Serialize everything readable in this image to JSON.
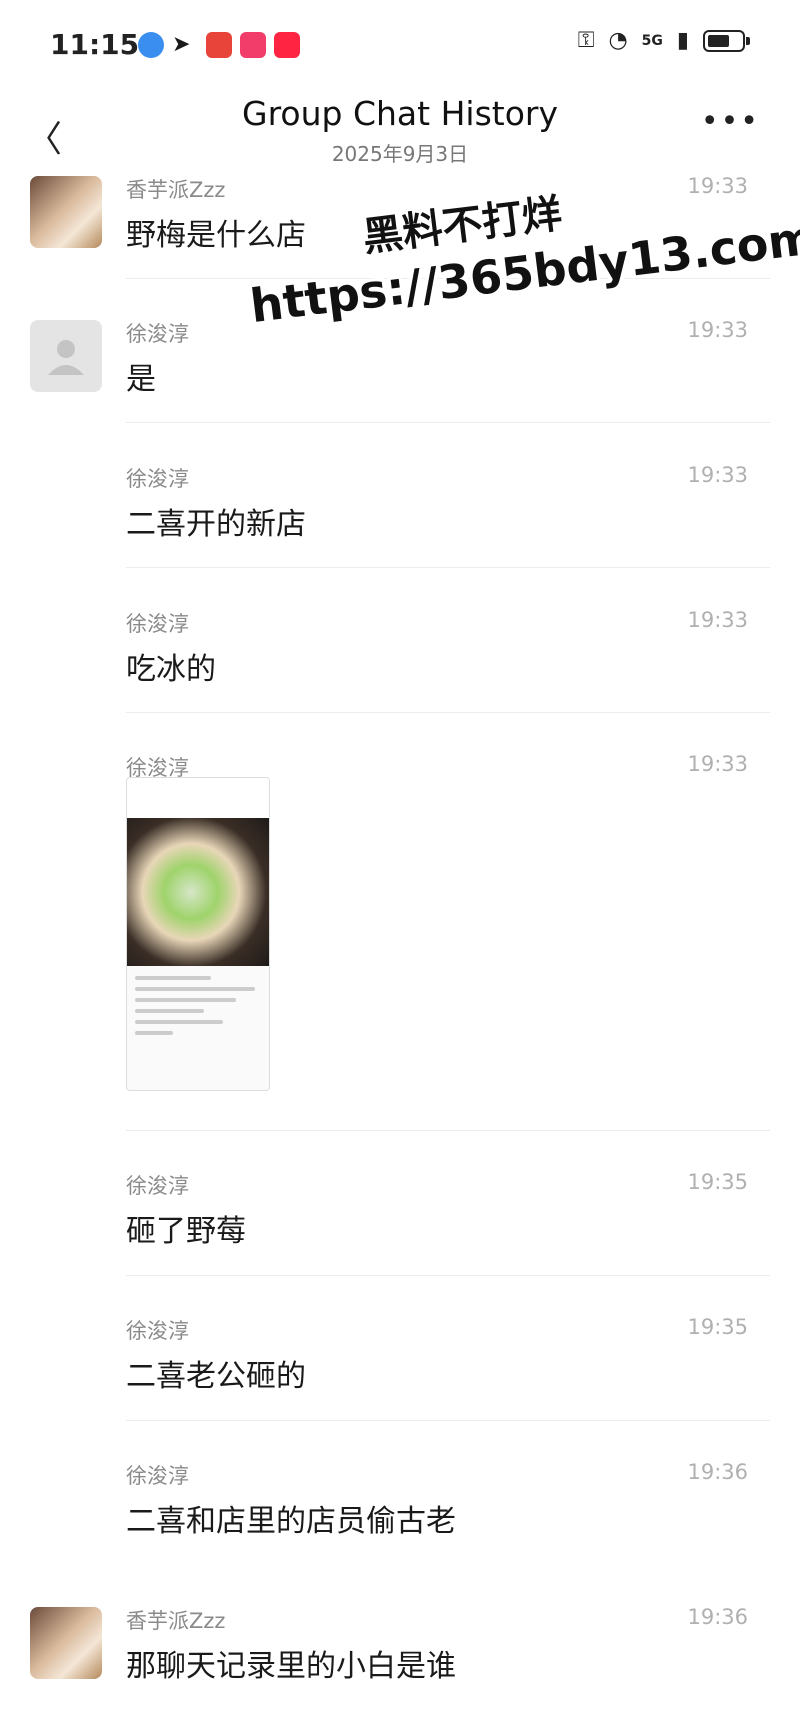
{
  "status_bar": {
    "time": "11:15",
    "network": "5G"
  },
  "header": {
    "title": "Group Chat History",
    "subtitle": "2025年9月3日"
  },
  "watermark": {
    "line1": "黑料不打烊",
    "line2": "https://365bdy13.com"
  },
  "messages": [
    {
      "sender": "香芋派Zzz",
      "time": "19:33",
      "text": "野梅是什么店"
    },
    {
      "sender": "徐浚淳",
      "time": "19:33",
      "text": "是"
    },
    {
      "sender": "徐浚淳",
      "time": "19:33",
      "text": "二喜开的新店"
    },
    {
      "sender": "徐浚淳",
      "time": "19:33",
      "text": "吃冰的"
    },
    {
      "sender": "徐浚淳",
      "time": "19:33",
      "text": ""
    },
    {
      "sender": "徐浚淳",
      "time": "19:35",
      "text": "砸了野莓"
    },
    {
      "sender": "徐浚淳",
      "time": "19:35",
      "text": "二喜老公砸的"
    },
    {
      "sender": "徐浚淳",
      "time": "19:36",
      "text": "二喜和店里的店员偷古老"
    },
    {
      "sender": "香芋派Zzz",
      "time": "19:36",
      "text": "那聊天记录里的小白是谁"
    }
  ]
}
